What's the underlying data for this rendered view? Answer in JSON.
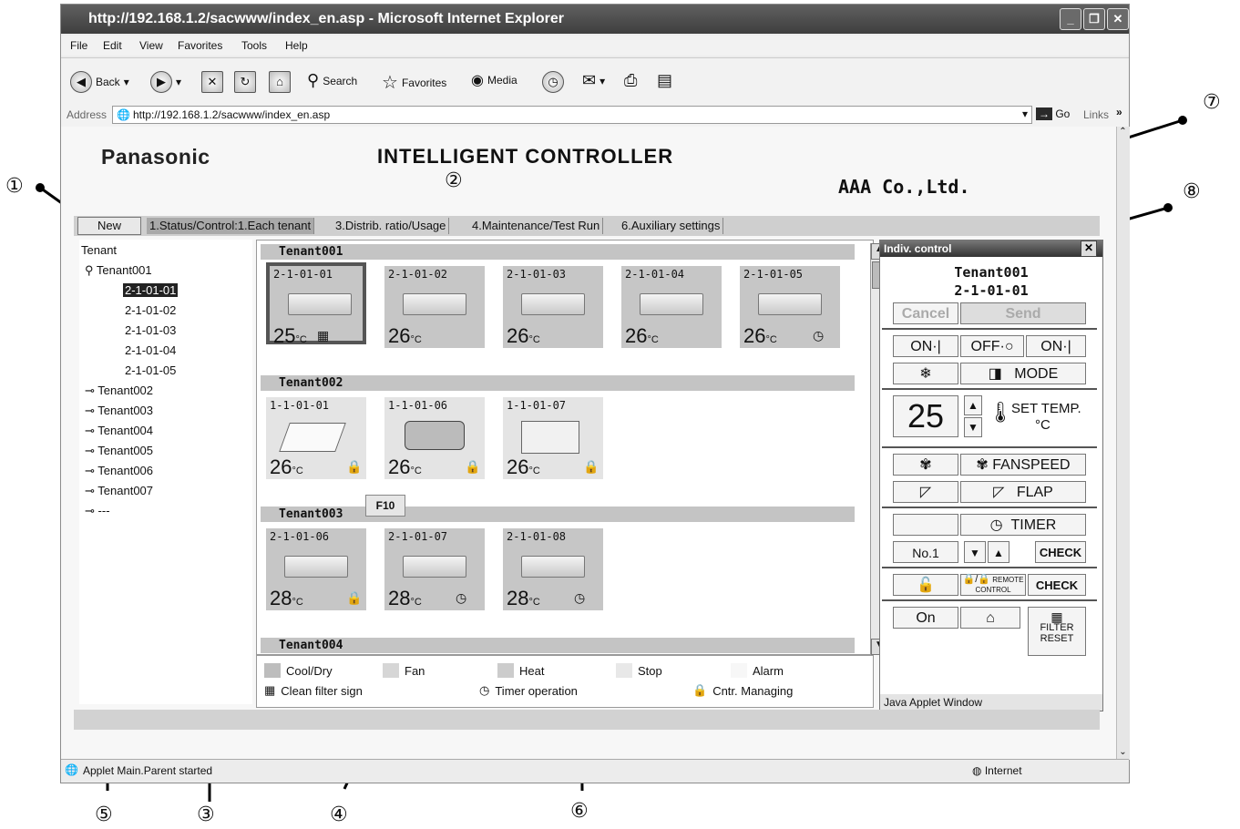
{
  "window": {
    "title": "http://192.168.1.2/sacwww/index_en.asp - Microsoft Internet Explorer"
  },
  "menu": [
    "File",
    "Edit",
    "View",
    "Favorites",
    "Tools",
    "Help"
  ],
  "toolbar": {
    "back": "Back",
    "search": "Search",
    "favorites": "Favorites",
    "media": "Media"
  },
  "address": {
    "label": "Address",
    "url": "http://192.168.1.2/sacwww/index_en.asp",
    "go": "Go",
    "links": "Links"
  },
  "page": {
    "brand": "Panasonic",
    "title": "INTELLIGENT CONTROLLER",
    "company": "AAA Co.,Ltd.",
    "new_button": "New",
    "tabs": [
      "1.Status/Control:1.Each tenant",
      "3.Distrib. ratio/Usage",
      "4.Maintenance/Test Run",
      "6.Auxiliary settings"
    ]
  },
  "tree": {
    "root": "Tenant",
    "tenant001": "Tenant001",
    "units": [
      "2-1-01-01",
      "2-1-01-02",
      "2-1-01-03",
      "2-1-01-04",
      "2-1-01-05"
    ],
    "tenants": [
      "Tenant002",
      "Tenant003",
      "Tenant004",
      "Tenant005",
      "Tenant006",
      "Tenant007",
      "---"
    ]
  },
  "groups": [
    {
      "name": "Tenant001",
      "units": [
        {
          "id": "2-1-01-01",
          "temp": "25",
          "unit": "°C",
          "icon": "filter"
        },
        {
          "id": "2-1-01-02",
          "temp": "26",
          "unit": "°C",
          "icon": ""
        },
        {
          "id": "2-1-01-03",
          "temp": "26",
          "unit": "°C",
          "icon": ""
        },
        {
          "id": "2-1-01-04",
          "temp": "26",
          "unit": "°C",
          "icon": ""
        },
        {
          "id": "2-1-01-05",
          "temp": "26",
          "unit": "°C",
          "icon": "timer"
        }
      ]
    },
    {
      "name": "Tenant002",
      "units": [
        {
          "id": "1-1-01-01",
          "temp": "26",
          "unit": "°C",
          "icon": "lock"
        },
        {
          "id": "1-1-01-06",
          "temp": "26",
          "unit": "°C",
          "icon": "lock"
        },
        {
          "id": "1-1-01-07",
          "temp": "26",
          "unit": "°C",
          "icon": "lock"
        }
      ]
    },
    {
      "name": "Tenant003",
      "units": [
        {
          "id": "2-1-01-06",
          "temp": "28",
          "unit": "°C",
          "icon": "lock"
        },
        {
          "id": "2-1-01-07",
          "temp": "28",
          "unit": "°C",
          "icon": "timer"
        },
        {
          "id": "2-1-01-08",
          "temp": "28",
          "unit": "°C",
          "icon": "timer"
        }
      ]
    },
    {
      "name": "Tenant004",
      "units": []
    }
  ],
  "f10": "F10",
  "legend": {
    "cool": "Cool/Dry",
    "fan": "Fan",
    "heat": "Heat",
    "stop": "Stop",
    "alarm": "Alarm",
    "filter": "Clean filter sign",
    "timer": "Timer operation",
    "managing": "Cntr. Managing"
  },
  "panel": {
    "header": "Indiv. control",
    "tenant": "Tenant001",
    "unit": "2-1-01-01",
    "cancel": "Cancel",
    "send": "Send",
    "on": "ON·|",
    "off": "OFF·○",
    "on2": "ON·|",
    "mode": "MODE",
    "set_temp": "25",
    "set_temp_label": "SET TEMP.",
    "set_temp_unit": "°C",
    "fanspeed": "FANSPEED",
    "flap": "FLAP",
    "timer": "TIMER",
    "timer_no": "No.1",
    "check": "CHECK",
    "remote": "REMOTE CONTROL",
    "check2": "CHECK",
    "on_state": "On",
    "filter_reset": "FILTER RESET",
    "footer": "Java Applet Window"
  },
  "status": {
    "left": "Applet Main.Parent started",
    "zone": "Internet"
  },
  "callouts": [
    "①",
    "②",
    "③",
    "④",
    "⑤",
    "⑥",
    "⑦",
    "⑧"
  ]
}
